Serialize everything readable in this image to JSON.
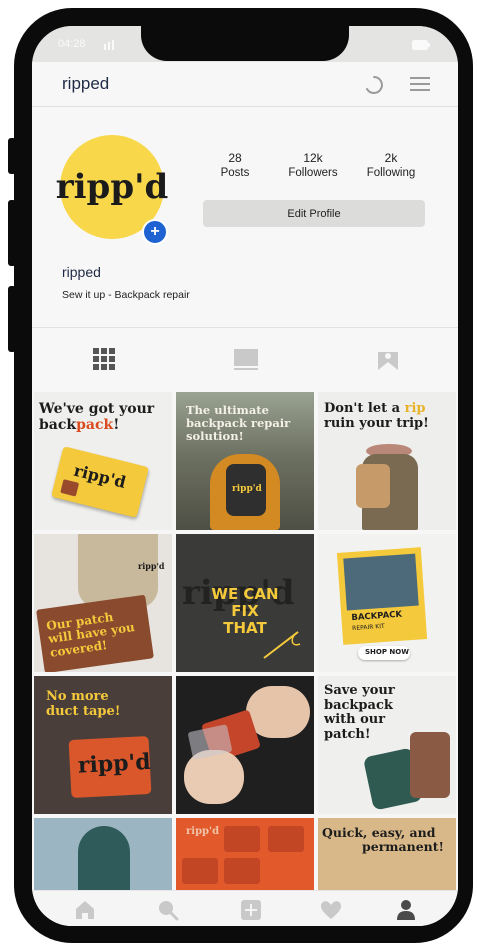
{
  "status_bar": {
    "time": "04:28"
  },
  "header": {
    "title": "ripped"
  },
  "profile": {
    "avatar_logo": "ripp'd",
    "stats": [
      {
        "value": "28",
        "label": "Posts"
      },
      {
        "value": "12k",
        "label": "Followers"
      },
      {
        "value": "2k",
        "label": "Following"
      }
    ],
    "edit_button": "Edit Profile",
    "name": "ripped",
    "bio": "Sew it up - Backpack repair"
  },
  "tabs": [
    "grid-icon",
    "feed-icon",
    "tagged-icon"
  ],
  "posts": [
    {
      "lines": [
        "We've got your",
        "back",
        "pack",
        "!"
      ],
      "logo": "ripp'd"
    },
    {
      "lines": [
        "The ultimate",
        "backpack repair",
        "solution!"
      ],
      "logo": "ripp'd"
    },
    {
      "lines": [
        "Don't let a ",
        "rip",
        "ruin your trip!"
      ]
    },
    {
      "lines": [
        "Our patch",
        "will have you",
        "covered!"
      ],
      "logo": "ripp'd"
    },
    {
      "lines": [
        "WE CAN FIX",
        "THAT"
      ],
      "logo": "ripp'd"
    },
    {
      "lines": [
        "BACKPACK",
        "REPAIR KIT",
        "SHOP NOW"
      ]
    },
    {
      "lines": [
        "No more",
        "duct tape!"
      ],
      "logo": "ripp'd"
    },
    {
      "lines": [],
      "logo": ""
    },
    {
      "lines": [
        "Save your",
        "backpack",
        "with our",
        "patch!"
      ]
    },
    {
      "lines": []
    },
    {
      "lines": [],
      "logo": "ripp'd"
    },
    {
      "lines": [
        "Quick, easy, and",
        "permanent!"
      ]
    }
  ],
  "bottom_nav": [
    "home-icon",
    "search-icon",
    "add-icon",
    "heart-icon",
    "profile-icon"
  ],
  "colors": {
    "accent_yellow": "#f8d84a",
    "badge_blue": "#1e63d1",
    "brand_navy": "#1f2a44"
  }
}
